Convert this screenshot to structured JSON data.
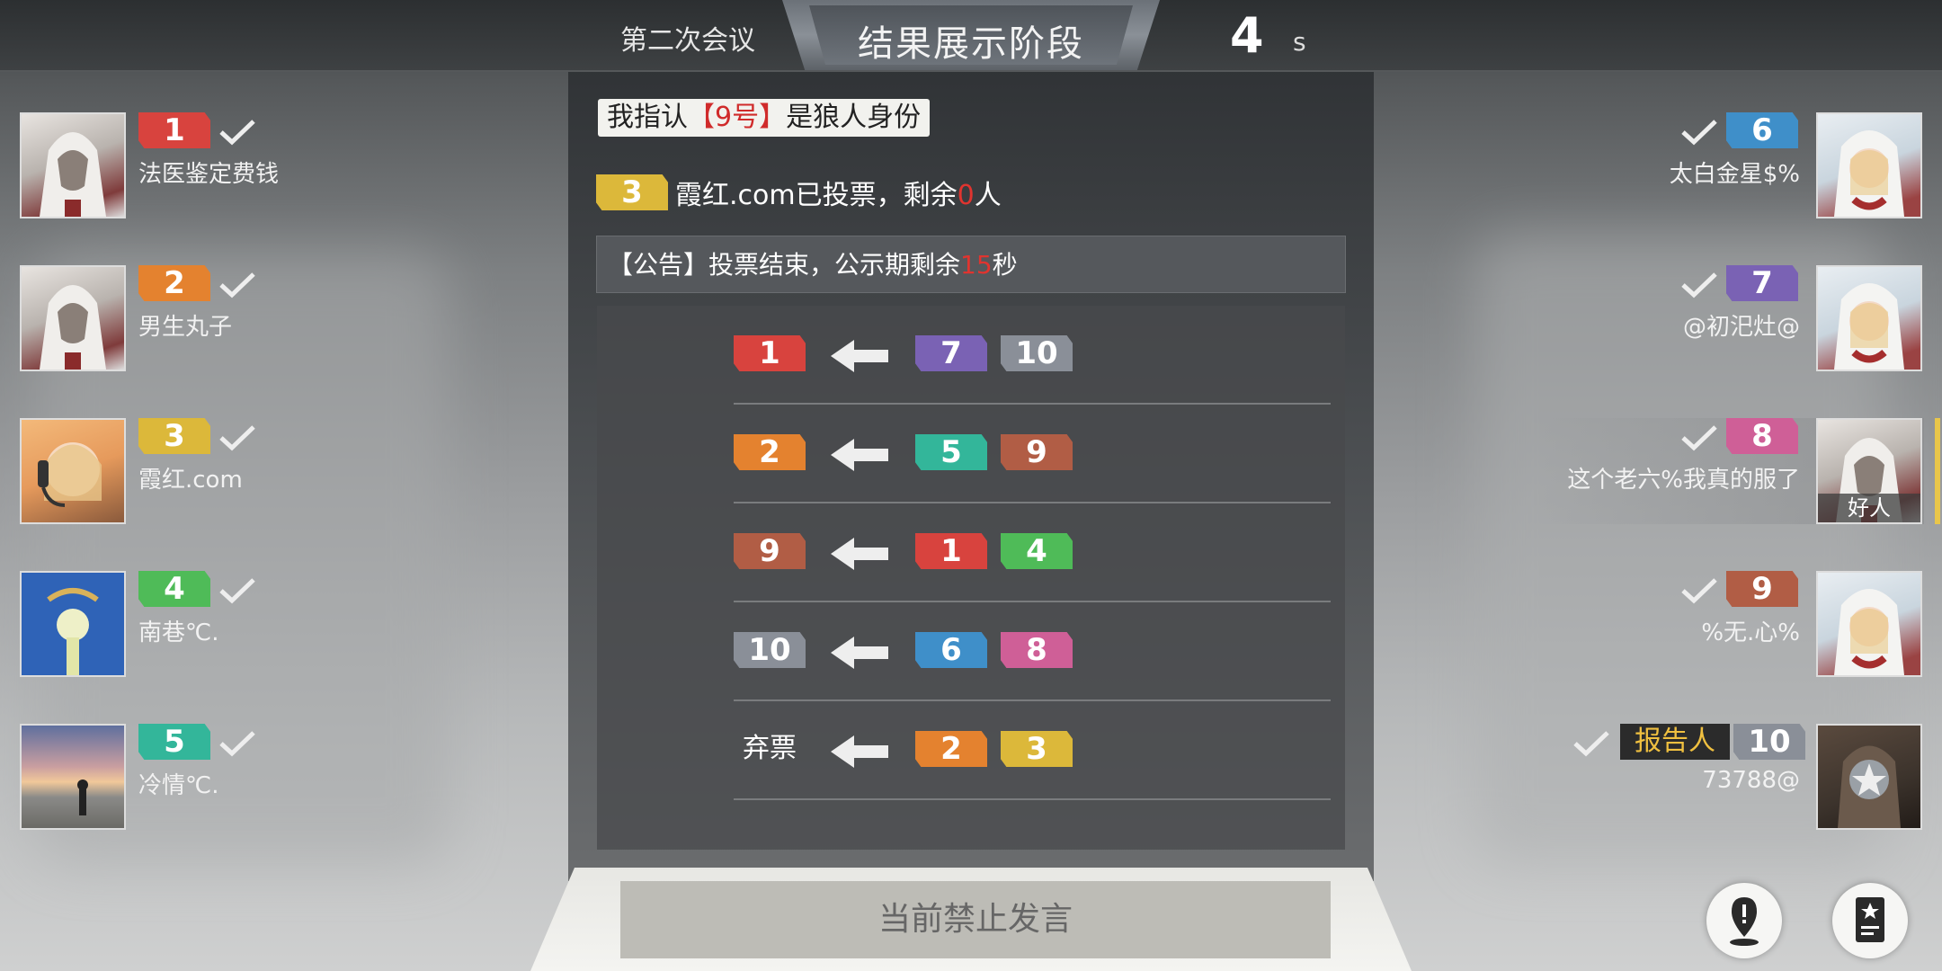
{
  "header": {
    "meeting_label": "第二次会议",
    "phase_title": "结果展示阶段",
    "timer_value": "4",
    "timer_unit": "s"
  },
  "speech": {
    "prefix": "我指认",
    "highlight": "【9号】",
    "suffix": "是狼人身份"
  },
  "voted_status": {
    "player_number": "3",
    "text_before": "霞红.com已投票，剩余",
    "remaining": "0",
    "text_after": "人"
  },
  "notice": {
    "text_before": "【公告】投票结束，公示期剩余",
    "seconds": "15",
    "text_after": "秒"
  },
  "colors": {
    "1": "#d8433e",
    "2": "#e4822f",
    "3": "#dcb83a",
    "4": "#4fbb58",
    "5": "#33b69a",
    "6": "#3f8fc9",
    "7": "#7a62b4",
    "8": "#cf5f97",
    "9": "#b15d45",
    "10": "#8a8f98"
  },
  "vote_results": [
    {
      "target": "1",
      "voters": [
        "7",
        "10"
      ]
    },
    {
      "target": "2",
      "voters": [
        "5",
        "9"
      ]
    },
    {
      "target": "9",
      "voters": [
        "1",
        "4"
      ]
    },
    {
      "target": "10",
      "voters": [
        "6",
        "8"
      ]
    },
    {
      "target_label": "弃票",
      "voters": [
        "2",
        "3"
      ]
    }
  ],
  "left_players": [
    {
      "number": "1",
      "name": "法医鉴定费钱",
      "avatar": "hooded-assassin"
    },
    {
      "number": "2",
      "name": "男生丸子",
      "avatar": "hooded-assassin"
    },
    {
      "number": "3",
      "name": "霞红.com",
      "avatar": "headset-girl"
    },
    {
      "number": "4",
      "name": "南巷℃.",
      "avatar": "sprout-doll"
    },
    {
      "number": "5",
      "name": "冷情℃.",
      "avatar": "sunset-beach"
    }
  ],
  "right_players": [
    {
      "number": "6",
      "name": "太白金星$%",
      "avatar": "white-hood-girl"
    },
    {
      "number": "7",
      "name": "@初汜灶@",
      "avatar": "white-hood-girl"
    },
    {
      "number": "8",
      "name": "这个老六%我真的服了",
      "avatar": "hooded-assassin",
      "tag": "好人"
    },
    {
      "number": "9",
      "name": "%无.心%",
      "avatar": "white-hood-girl"
    },
    {
      "number": "10",
      "name": "73788@",
      "avatar": "masked-emblem",
      "role": "报告人"
    }
  ],
  "bottom": {
    "mute_text": "当前禁止发言"
  }
}
